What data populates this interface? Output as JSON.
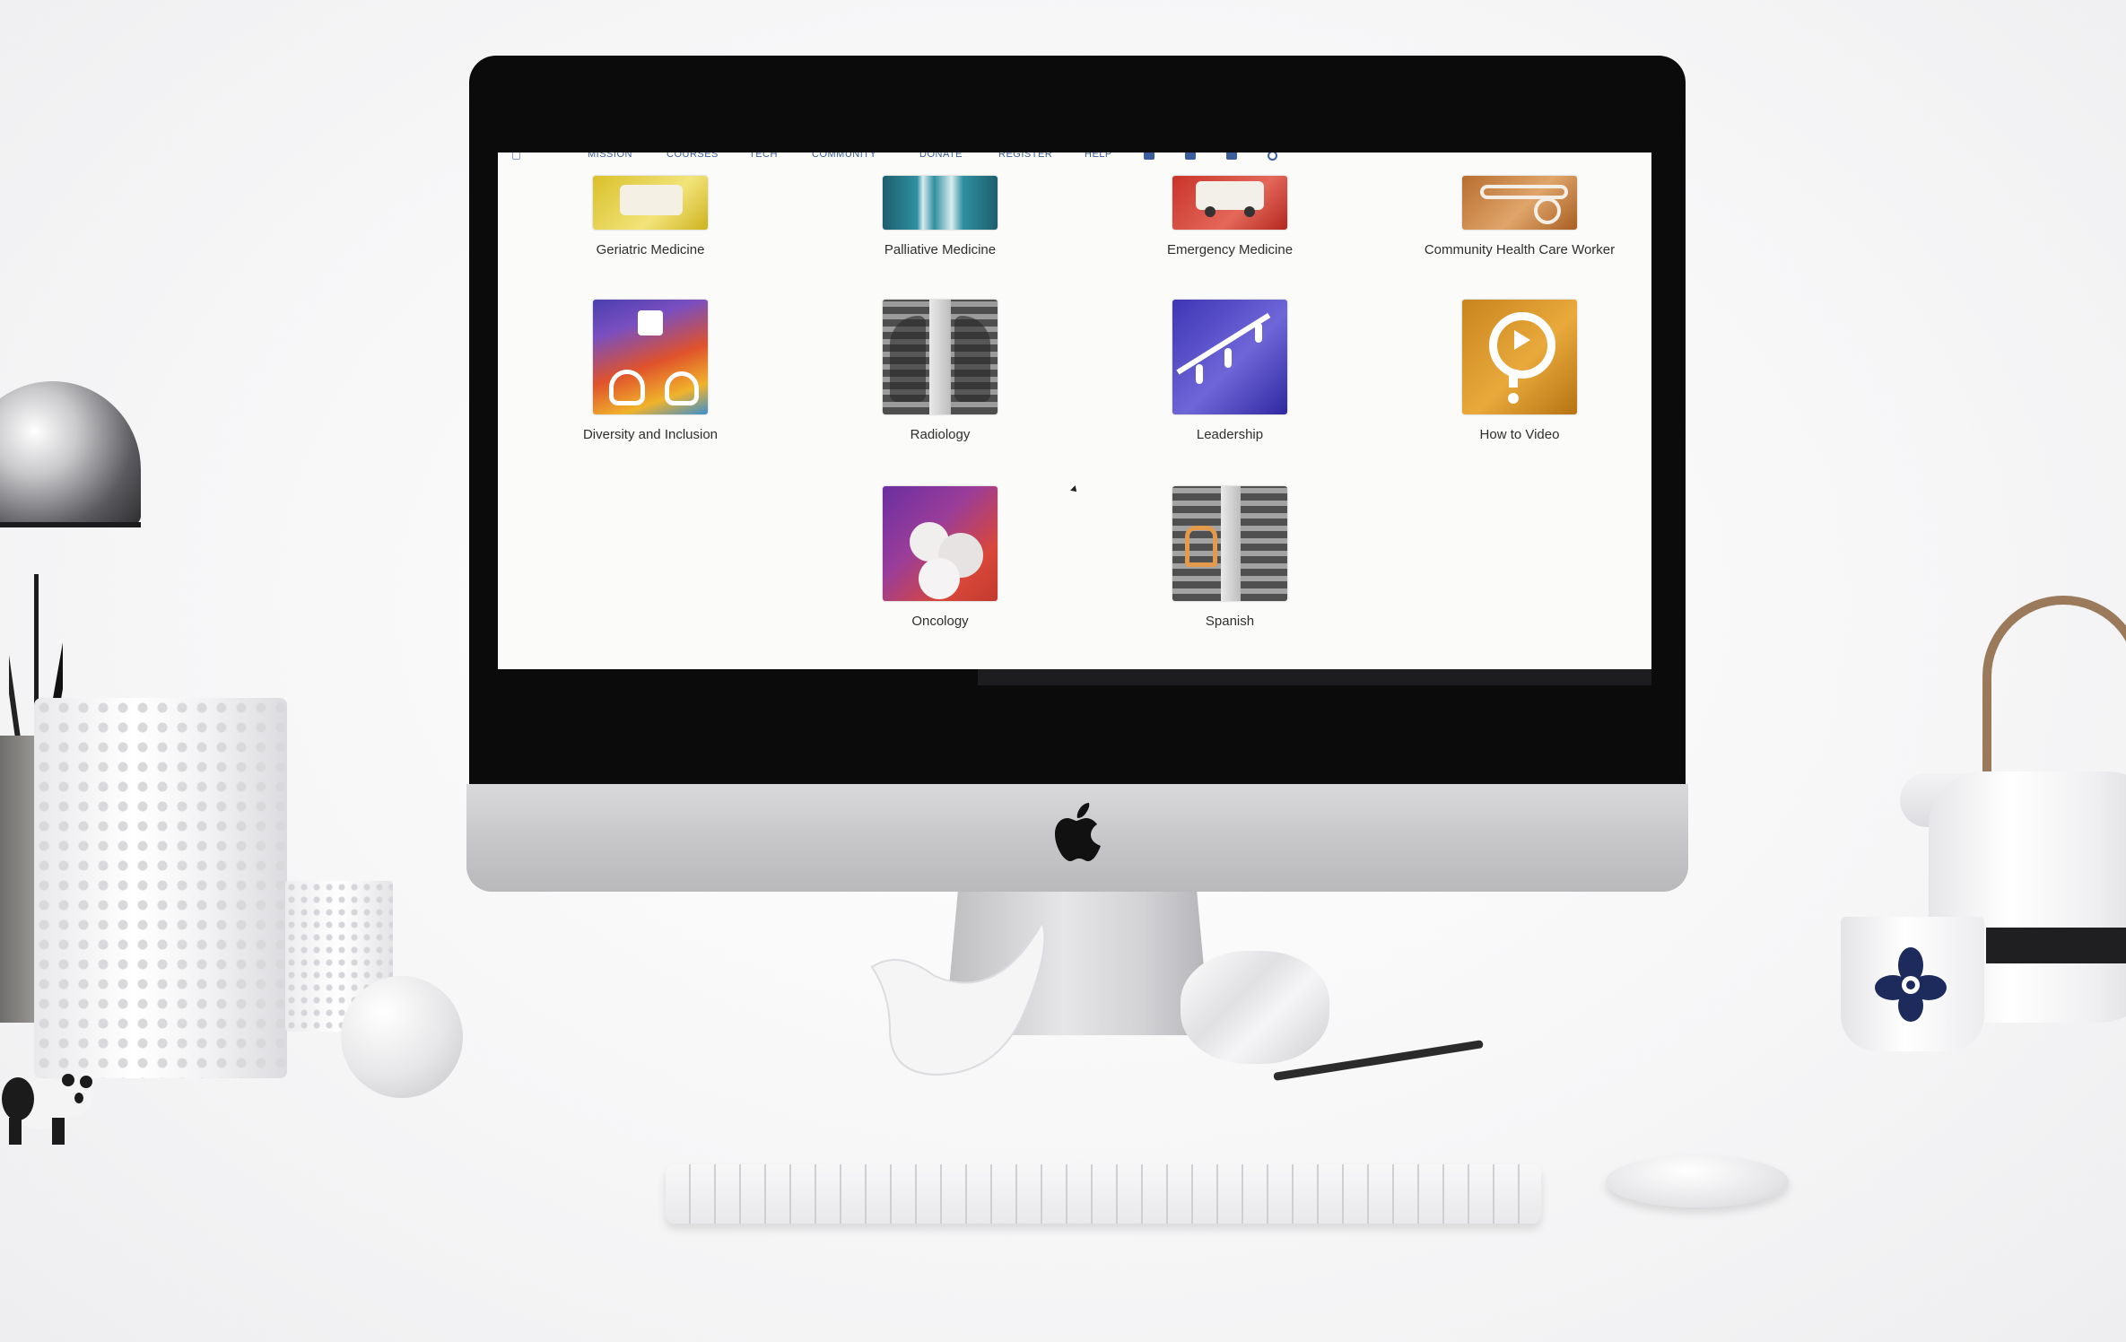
{
  "nav": {
    "items": [
      "MISSION",
      "COURSES",
      "TECH",
      "COMMUNITY",
      "DONATE",
      "REGISTER",
      "HELP"
    ],
    "icons": [
      "facebook-icon",
      "twitter-icon",
      "instagram-icon",
      "search-icon"
    ]
  },
  "courses": [
    {
      "label": "Geriatric Medicine",
      "color_a": "#d9c02a",
      "color_b": "#f2e47a",
      "icon": "ambulance-illustration"
    },
    {
      "label": "Palliative Medicine",
      "color_a": "#2f8fa0",
      "color_b": "#1d5e6e",
      "icon": "hands-illustration"
    },
    {
      "label": "Emergency Medicine",
      "color_a": "#c9332a",
      "color_b": "#e4685a",
      "icon": "ambulance-illustration"
    },
    {
      "label": "Community Health Care Worker",
      "color_a": "#b86d2f",
      "color_b": "#e0a56a",
      "icon": "stethoscope-illustration"
    },
    {
      "label": "Diversity and Inclusion",
      "color_a": "#4a3fb0",
      "color_b": "#e0522b",
      "icon": "hands-illustration"
    },
    {
      "label": "Radiology",
      "color_a": "#5a5a5a",
      "color_b": "#c7c7c7",
      "icon": "xray-illustration"
    },
    {
      "label": "Leadership",
      "color_a": "#3d35b5",
      "color_b": "#6f66d8",
      "icon": "stairs-illustration"
    },
    {
      "label": "How to Video",
      "color_a": "#c8841e",
      "color_b": "#e9a93b",
      "icon": "question-play-illustration"
    },
    {
      "label": "Oncology",
      "color_a": "#6a2fa0",
      "color_b": "#d8473a",
      "icon": "cells-illustration"
    },
    {
      "label": "Spanish",
      "color_a": "#555555",
      "color_b": "#bdbdbd",
      "icon": "xray-illustration"
    }
  ],
  "device": {
    "brand_icon": "apple-logo-icon"
  }
}
